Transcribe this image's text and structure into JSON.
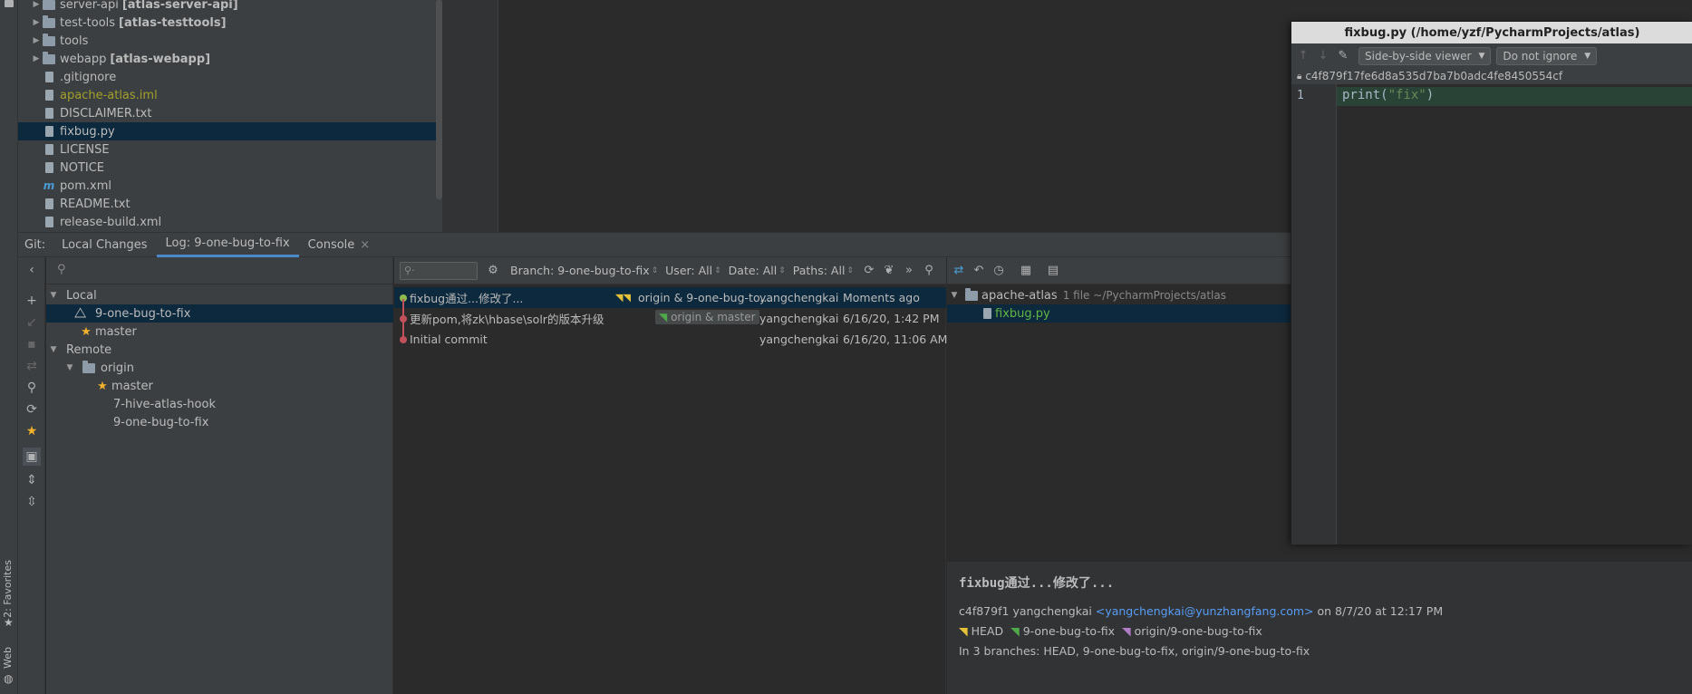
{
  "sidebar": {
    "favorites_label": "2: Favorites",
    "web_label": "Web"
  },
  "project_tree": [
    {
      "name": "server-api",
      "module": "[atlas-server-api]",
      "type": "folder",
      "expandable": true
    },
    {
      "name": "test-tools",
      "module": "[atlas-testtools]",
      "type": "folder",
      "expandable": true
    },
    {
      "name": "tools",
      "module": "",
      "type": "folder",
      "expandable": true
    },
    {
      "name": "webapp",
      "module": "[atlas-webapp]",
      "type": "folder",
      "expandable": true
    },
    {
      "name": ".gitignore",
      "module": "",
      "type": "file"
    },
    {
      "name": "apache-atlas.iml",
      "module": "",
      "type": "file",
      "color": "#a2a02b"
    },
    {
      "name": "DISCLAIMER.txt",
      "module": "",
      "type": "file"
    },
    {
      "name": "fixbug.py",
      "module": "",
      "type": "file",
      "selected": true
    },
    {
      "name": "LICENSE",
      "module": "",
      "type": "file"
    },
    {
      "name": "NOTICE",
      "module": "",
      "type": "file"
    },
    {
      "name": "pom.xml",
      "module": "",
      "type": "maven"
    },
    {
      "name": "README.txt",
      "module": "",
      "type": "file"
    },
    {
      "name": "release-build.xml",
      "module": "",
      "type": "file"
    }
  ],
  "git_window": {
    "label": "Git:",
    "tabs": [
      "Local Changes",
      "Log: 9-one-bug-to-fix",
      "Console"
    ],
    "close_glyph": "×"
  },
  "branches": {
    "local_label": "Local",
    "local": [
      {
        "name": "9-one-bug-to-fix",
        "icon": "tag-icon",
        "selected": true
      },
      {
        "name": "master",
        "icon": "star-icon"
      }
    ],
    "remote_label": "Remote",
    "origin_label": "origin",
    "remote": [
      {
        "name": "master",
        "icon": "star-icon"
      },
      {
        "name": "7-hive-atlas-hook",
        "icon": ""
      },
      {
        "name": "9-one-bug-to-fix",
        "icon": ""
      }
    ]
  },
  "log_toolbar": {
    "branch": "Branch: 9-one-bug-to-fix",
    "user": "User: All",
    "date": "Date: All",
    "paths": "Paths: All"
  },
  "commits": [
    {
      "message": "fixbug通过...修改了...",
      "refs": "origin & 9-one-bug-to...",
      "author": "yangchengkai",
      "date": "Moments ago",
      "dot_color": "#8fb84e",
      "selected": true
    },
    {
      "message": "更新pom,将zk\\hbase\\solr的版本升级",
      "refs": "origin & master",
      "author": "yangchengkai",
      "date": "6/16/20, 1:42 PM",
      "dot_color": "#c0505a"
    },
    {
      "message": "Initial commit",
      "refs": "",
      "author": "yangchengkai",
      "date": "6/16/20, 11:06 AM",
      "dot_color": "#c0505a"
    }
  ],
  "changes": {
    "root": "apache-atlas",
    "summary": "1 file ~/PycharmProjects/atlas",
    "file": "fixbug.py",
    "file_color": "#62b543"
  },
  "commit_details": {
    "subject": "fixbug通过...修改了...",
    "hash": "c4f879f1",
    "author": "yangchengkai",
    "email": "<yangchengkai@yunzhangfang.com>",
    "date_text": "on 8/7/20 at 12:17 PM",
    "refs": [
      {
        "name": "HEAD",
        "color": "#e5c13a"
      },
      {
        "name": "9-one-bug-to-fix",
        "color": "#4fa84a"
      },
      {
        "name": "origin/9-one-bug-to-fix",
        "color": "#b07cc6"
      }
    ],
    "branches_text": "In 3 branches: HEAD, 9-one-bug-to-fix, origin/9-one-bug-to-fix"
  },
  "diff_window": {
    "title": "fixbug.py (/home/yzf/PycharmProjects/atlas)",
    "viewer": "Side-by-side viewer",
    "ignore": "Do not ignore",
    "revision": "c4f879f17fe6d8a535d7ba7b0adc4fe8450554cf",
    "line_number": "1",
    "code_fn": "print(",
    "code_str": "\"fix\"",
    "code_end": ")"
  }
}
